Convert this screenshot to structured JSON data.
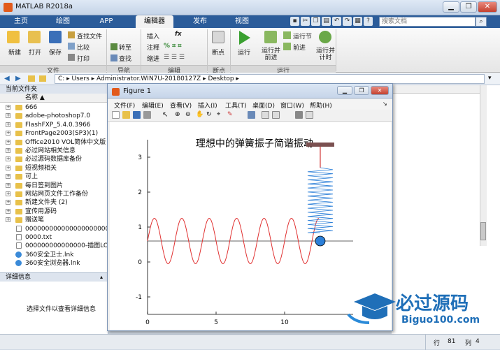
{
  "window": {
    "title": "MATLAB R2018a",
    "controls": {
      "minimize": "▁",
      "restore": "❐",
      "close": "✕"
    }
  },
  "tabs": [
    {
      "label": "主页"
    },
    {
      "label": "绘图"
    },
    {
      "label": "APP"
    },
    {
      "label": "编辑器"
    },
    {
      "label": "发布"
    },
    {
      "label": "视图"
    }
  ],
  "search": {
    "placeholder": "搜索文档"
  },
  "ribbon": {
    "file": {
      "new": "新建",
      "open": "打开",
      "save": "保存",
      "find_files": "查找文件",
      "compare": "比较",
      "print": "打印",
      "group": "文件"
    },
    "navigate": {
      "goto": "转至",
      "find": "查找",
      "group": "导航"
    },
    "edit": {
      "insert": "插入",
      "fx": "fx",
      "comment": "注释",
      "indent": "缩进",
      "group": "编辑"
    },
    "breakpoints": {
      "label": "断点",
      "group": "断点"
    },
    "run": {
      "run": "运行",
      "run_advance": "运行并\n前进",
      "run_section": "运行节",
      "advance": "前进",
      "run_time": "运行并\n计时",
      "group": "运行"
    }
  },
  "address": {
    "path": "C: ▸ Users ▸ Administrator.WIN7U-20180127Z ▸ Desktop ▸"
  },
  "file_panel": {
    "title": "当前文件夹",
    "column_name": "名称 ▲",
    "items": [
      {
        "name": "666",
        "type": "folder"
      },
      {
        "name": "adobe-photoshop7.0",
        "type": "folder"
      },
      {
        "name": "FlashFXP_5.4.0.3966",
        "type": "folder"
      },
      {
        "name": "FrontPage2003(SP3)(1)",
        "type": "folder"
      },
      {
        "name": "Office2010 VOL简体中文版",
        "type": "folder"
      },
      {
        "name": "必过网站相关信息",
        "type": "folder"
      },
      {
        "name": "必过源码数据库备份",
        "type": "folder"
      },
      {
        "name": "短视频相关",
        "type": "folder"
      },
      {
        "name": "可上",
        "type": "folder"
      },
      {
        "name": "每日签到图片",
        "type": "folder"
      },
      {
        "name": "网站网页文件工作备份",
        "type": "folder"
      },
      {
        "name": "新建文件夹 (2)",
        "type": "folder"
      },
      {
        "name": "宣传用源码",
        "type": "folder"
      },
      {
        "name": "赠送笔",
        "type": "folder"
      },
      {
        "name": "000000000000000000000000...",
        "type": "file"
      },
      {
        "name": "0000.txt",
        "type": "file"
      },
      {
        "name": "000000000000000-插图LO...",
        "type": "file"
      },
      {
        "name": "360安全卫士.lnk",
        "type": "link"
      },
      {
        "name": "360安全浏览器.lnk",
        "type": "link"
      }
    ]
  },
  "detail_panel": {
    "title": "详细信息",
    "message": "选择文件以查看详细信息"
  },
  "figure": {
    "title": "Figure 1",
    "menus": [
      "文件(F)",
      "编辑(E)",
      "查看(V)",
      "插入(I)",
      "工具(T)",
      "桌面(D)",
      "窗口(W)",
      "帮助(H)"
    ],
    "plot_title": "理想中的弹簧振子简谐振动"
  },
  "chart_data": {
    "type": "line",
    "title": "理想中的弹簧振子简谐振动",
    "xlim": [
      0,
      15
    ],
    "ylim": [
      -1.5,
      3.5
    ],
    "xticks": [
      0,
      5,
      10
    ],
    "yticks": [
      -1,
      0,
      1,
      2,
      3
    ],
    "grid": false,
    "series": [
      {
        "color": "#e03030",
        "function": "sin(2*pi*x/2)",
        "x_range": [
          0,
          12.5
        ]
      }
    ],
    "annotations": {
      "equilibrium_line_y": 0.6,
      "ball_center": [
        12.6,
        0.6
      ],
      "spring_top_y": 3.3,
      "ball_color": "#2b7fd8",
      "spring_color": "#2b7fd8",
      "mount_color": "#7a5050"
    }
  },
  "status": {
    "row_label": "行",
    "row": "81",
    "col_label": "列",
    "col": "4"
  },
  "watermark": {
    "text_cn": "必过源码",
    "text_en": "Biguo100.com"
  }
}
